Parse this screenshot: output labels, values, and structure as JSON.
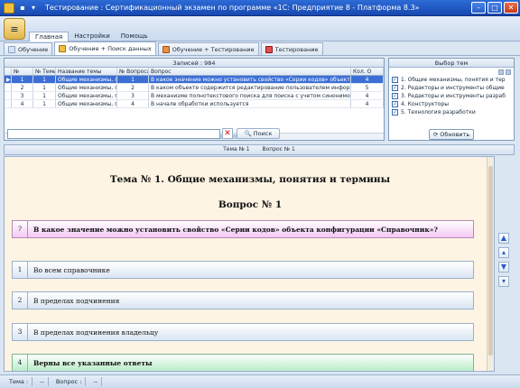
{
  "window": {
    "title": "Тестирование : Сертификационный экзамен по программе «1С: Предприятие 8 - Платформа 8.3»",
    "controls": {
      "minimize": "–",
      "maximize": "□",
      "close": "✕"
    }
  },
  "ribbon": {
    "orb_icon": "app-menu-icon",
    "menu": [
      "Главная",
      "Настройки",
      "Помощь"
    ]
  },
  "tabs": [
    {
      "label": "Обучение",
      "color": "#d8e4f4"
    },
    {
      "label": "Обучение + Поиск данных",
      "color": "#f0c040"
    },
    {
      "label": "Обучение + Тестирование",
      "color": "#e89048"
    },
    {
      "label": "Тестирование",
      "color": "#e05050"
    }
  ],
  "grid": {
    "caption": "Записей : 984",
    "columns": [
      "",
      "№",
      "№ Темы",
      "Название темы",
      "№ Вопроса",
      "Вопрос",
      "Кол. О"
    ],
    "rows": [
      [
        "▶",
        "1",
        "1",
        "Общие механизмы, п",
        "1",
        "В какое значение можно установить свойство «Серии кодов» объекта",
        "4"
      ],
      [
        "",
        "2",
        "1",
        "Общие механизмы, п",
        "2",
        "В каком объекте содержится редактирование пользователем информа",
        "5"
      ],
      [
        "",
        "3",
        "1",
        "Общие механизмы, п",
        "3",
        "В механизме полнотекстового поиска для поиска с учетом синонимов",
        "4"
      ],
      [
        "",
        "4",
        "1",
        "Общие механизмы, п",
        "4",
        "В начале обработки используется",
        "4"
      ]
    ],
    "search_placeholder": "",
    "clear_label": "✕",
    "search_label": "Поиск"
  },
  "themes": {
    "caption": "Выбор тем",
    "items": [
      "1. Общие механизмы, понятия и тер",
      "2. Редакторы и инструменты общие",
      "3. Редакторы и инструменты разраб",
      "4. Конструкторы",
      "5. Технология разработки"
    ],
    "refresh_label": "Обновить"
  },
  "question_bar": {
    "topic": "Тема № 1",
    "question": "Вопрос № 1"
  },
  "content": {
    "topic_title": "Тема № 1. Общие механизмы, понятия и термины",
    "question_title": "Вопрос № 1",
    "question_mark": "?",
    "question_text": "В какое значение можно установить свойство «Серии кодов» объекта конфигурации «Справочник»?",
    "answers": [
      {
        "num": "1",
        "text": "Во всем справочнике"
      },
      {
        "num": "2",
        "text": "В пределах подчинения"
      },
      {
        "num": "3",
        "text": "В пределах подчинения владельцу"
      },
      {
        "num": "4",
        "text": "Верны все указанные ответы"
      }
    ]
  },
  "nav": {
    "up": "▲",
    "top": "▴",
    "down": "▼",
    "bottom": "▾"
  },
  "status": {
    "topic_label": "Тема :",
    "topic_value": "--",
    "question_label": "Вопрос :",
    "question_value": "--"
  }
}
